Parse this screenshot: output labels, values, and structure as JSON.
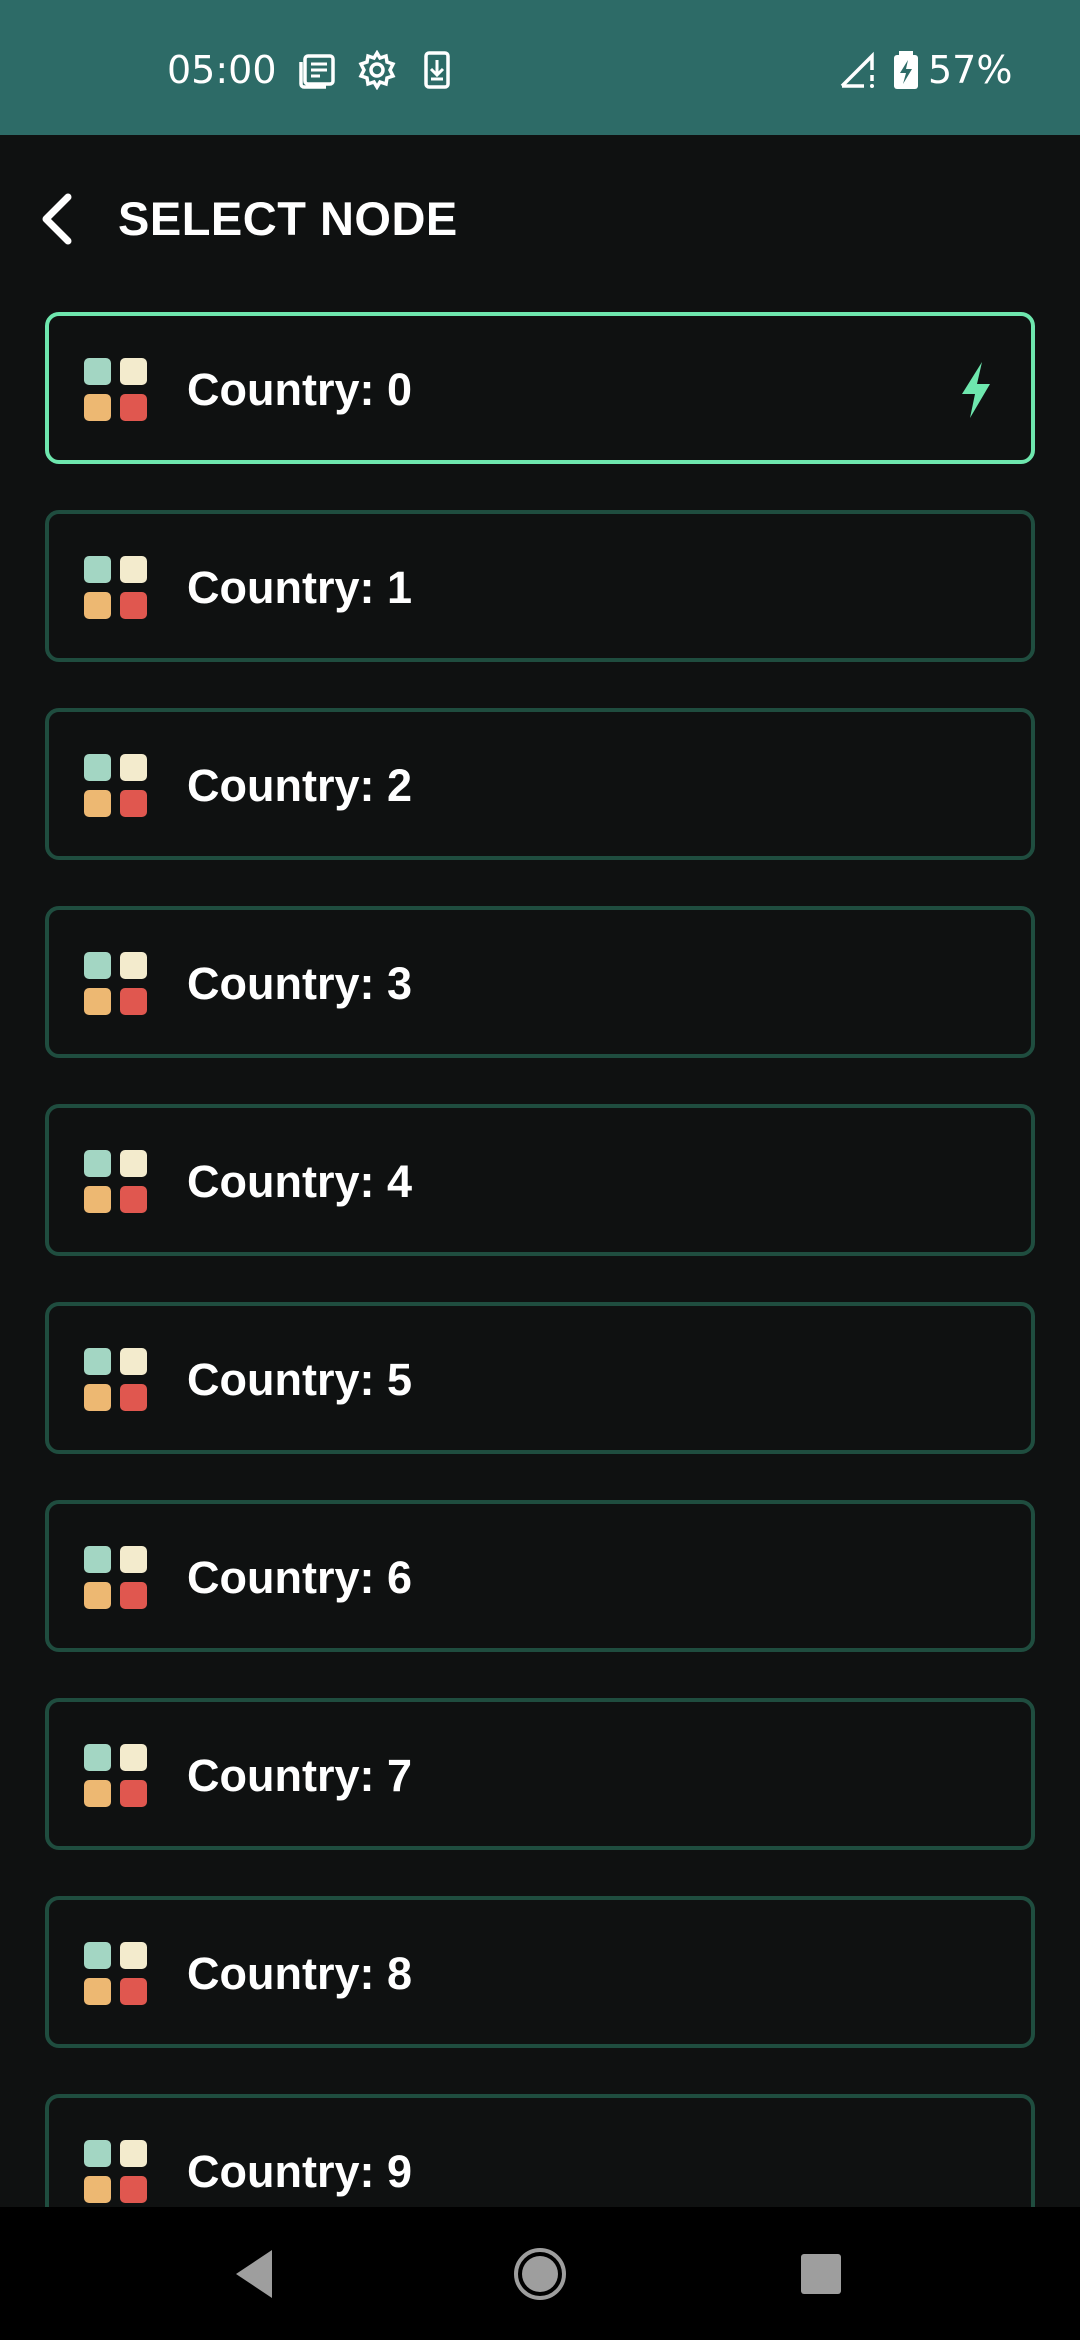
{
  "status_bar": {
    "time": "05:00",
    "battery": "57%",
    "icons": [
      "news-icon",
      "settings-icon",
      "download-icon",
      "signal-icon",
      "battery-charging-icon"
    ]
  },
  "header": {
    "title": "SELECT NODE",
    "back_icon": "chevron-left-icon"
  },
  "nodes": [
    {
      "label": "Country: 0",
      "selected": true
    },
    {
      "label": "Country: 1",
      "selected": false
    },
    {
      "label": "Country: 2",
      "selected": false
    },
    {
      "label": "Country: 3",
      "selected": false
    },
    {
      "label": "Country: 4",
      "selected": false
    },
    {
      "label": "Country: 5",
      "selected": false
    },
    {
      "label": "Country: 6",
      "selected": false
    },
    {
      "label": "Country: 7",
      "selected": false
    },
    {
      "label": "Country: 8",
      "selected": false
    },
    {
      "label": "Country: 9",
      "selected": false
    }
  ],
  "colors": {
    "status_bar": "#2d6b67",
    "background": "#0f1111",
    "selected_border": "#6ee7ae",
    "item_border": "#1f4d3f",
    "icon_tl": "#a3d6c3",
    "icon_tr": "#f3ebcd",
    "icon_bl": "#edb872",
    "icon_br": "#e0574f"
  },
  "nav_bar": {
    "buttons": [
      "back-triangle-icon",
      "home-circle-icon",
      "recents-square-icon"
    ]
  }
}
